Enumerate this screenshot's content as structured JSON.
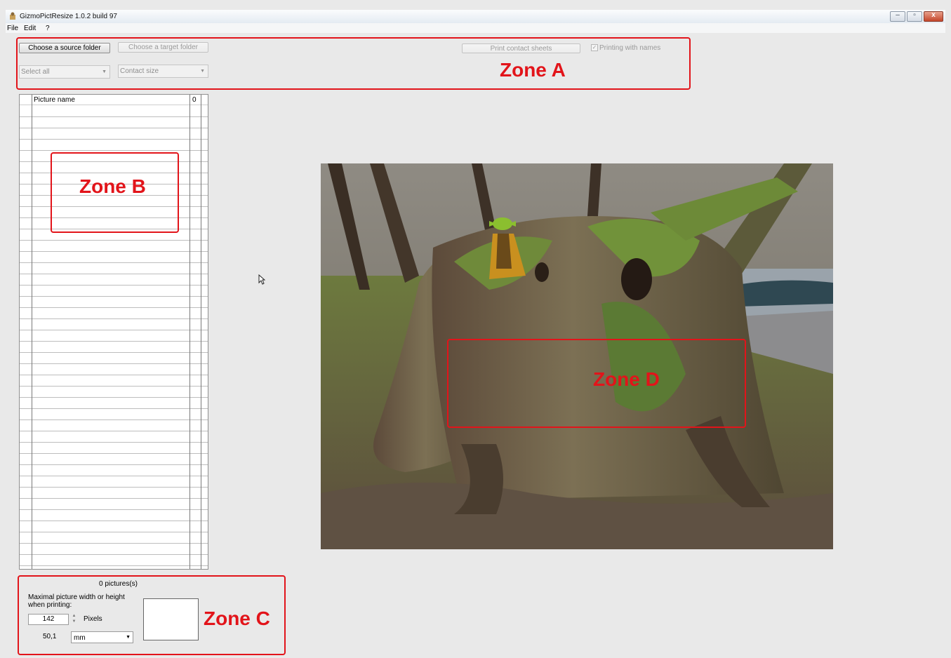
{
  "window": {
    "title": "GizmoPictResize 1.0.2 build 97",
    "icon": "app-logo-icon",
    "controls": {
      "minimize": "–",
      "maximize": "▫",
      "close": "x"
    }
  },
  "menu": {
    "items": [
      "File",
      "Edit",
      "?"
    ]
  },
  "toolbar": {
    "source_button": "Choose a source folder",
    "target_button": "Choose a target folder",
    "print_button": "Print contact sheets",
    "printing_with_names": {
      "label": "Printing with names",
      "checked": true
    },
    "select_combo": "Select all",
    "contact_size_combo": "Contact size"
  },
  "table": {
    "columns": [
      "Picture name",
      "0"
    ],
    "rows": []
  },
  "bottom_panel": {
    "count_text": "0 pictures(s)",
    "max_label": "Maximal picture width or height when printing:",
    "size_value": "142",
    "size_unit": "Pixels",
    "mm_value": "50,1",
    "unit_select": "mm"
  },
  "annotations": {
    "zone_a": "Zone A",
    "zone_b": "Zone B",
    "zone_c": "Zone C",
    "zone_d": "Zone D",
    "color": "#e2141a"
  },
  "preview_image": {
    "subject": "mossy tree stump with small green figure",
    "icons": [
      "cursor-pointer-icon"
    ]
  }
}
